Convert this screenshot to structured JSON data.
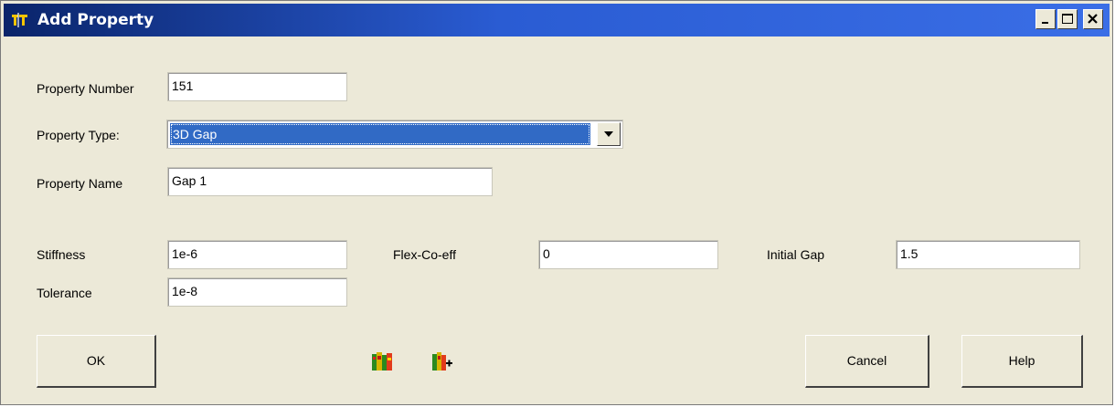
{
  "window": {
    "title": "Add Property",
    "controls": [
      "minimize",
      "maximize",
      "close"
    ]
  },
  "form": {
    "property_number": {
      "label": "Property Number",
      "value": "151"
    },
    "property_type": {
      "label": "Property Type:",
      "selected": "3D Gap"
    },
    "property_name": {
      "label": "Property Name",
      "value": "Gap 1"
    },
    "stiffness": {
      "label": "Stiffness",
      "value": "1e-6"
    },
    "flex_coeff": {
      "label": "Flex-Co-eff",
      "value": "0"
    },
    "initial_gap": {
      "label": "Initial Gap",
      "value": "1.5"
    },
    "tolerance": {
      "label": "Tolerance",
      "value": "1e-8"
    }
  },
  "buttons": {
    "ok": "OK",
    "cancel": "Cancel",
    "help": "Help"
  },
  "toolbar_icons": [
    "library-icon",
    "library-add-icon"
  ],
  "colors": {
    "title_bar_start": "#0a246a",
    "title_bar_end": "#3a6ee6",
    "dialog_background": "#ece9d8",
    "selection": "#316ac5"
  }
}
